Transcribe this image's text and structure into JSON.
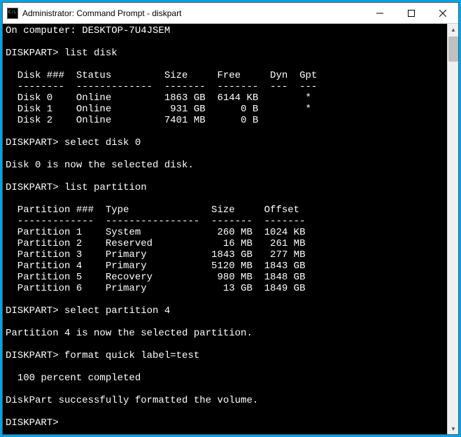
{
  "window": {
    "title": "Administrator: Command Prompt - diskpart"
  },
  "session": {
    "computer_line": "On computer: DESKTOP-7U4JSEM",
    "prompt": "DISKPART>",
    "commands": {
      "list_disk": "list disk",
      "select_disk": "select disk 0",
      "list_partition": "list partition",
      "select_partition": "select partition 4",
      "format": "format quick label=test"
    },
    "disk_table": {
      "header": "  Disk ###  Status         Size     Free     Dyn  Gpt",
      "divider": "  --------  -------------  -------  -------  ---  ---",
      "rows": [
        "  Disk 0    Online         1863 GB  6144 KB        *",
        "  Disk 1    Online          931 GB      0 B        *",
        "  Disk 2    Online         7401 MB      0 B"
      ]
    },
    "select_disk_response": "Disk 0 is now the selected disk.",
    "partition_table": {
      "header": "  Partition ###  Type              Size     Offset",
      "divider": "  -------------  ----------------  -------  -------",
      "rows": [
        "  Partition 1    System             260 MB  1024 KB",
        "  Partition 2    Reserved            16 MB   261 MB",
        "  Partition 3    Primary           1843 GB   277 MB",
        "  Partition 4    Primary           5120 MB  1843 GB",
        "  Partition 5    Recovery           980 MB  1848 GB",
        "  Partition 6    Primary             13 GB  1849 GB"
      ]
    },
    "select_partition_response": "Partition 4 is now the selected partition.",
    "format_progress": "  100 percent completed",
    "format_success": "DiskPart successfully formatted the volume."
  }
}
